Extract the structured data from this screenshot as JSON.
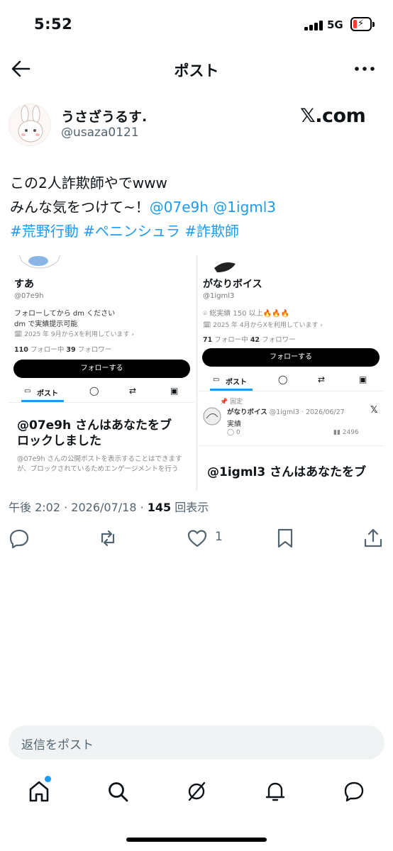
{
  "status": {
    "time": "5:52",
    "network": "5G"
  },
  "header": {
    "title": "ポスト"
  },
  "author": {
    "name": "うさざうるす.",
    "handle": "@usaza0121",
    "source": "𝕏.com"
  },
  "post": {
    "line1": "この2人詐欺師やでwww",
    "line2_prefix": "みんな気をつけて~！",
    "mention1": "@07e9h",
    "mention2": "@1igml3",
    "hashtag1": "#荒野行動",
    "hashtag2": "#ペニンシュラ",
    "hashtag3": "#詐欺師"
  },
  "embed": {
    "left": {
      "name": "すあ",
      "handle": "@07e9h",
      "bio1": "フォローしてから dm ください",
      "bio2": "dm で実績提示可能",
      "joined": "2025 年 9月からXを利用しています ›",
      "following_count": "110",
      "following_label": "フォロー中",
      "followers_count": "39",
      "followers_label": "フォロワー",
      "follow_button": "フォローする",
      "tab_post": "ポスト",
      "block_title1": "@07e9h さんはあなたをブ",
      "block_title2": "ロックしました",
      "block_desc1": "@07e9h さんの公開ポストを表示することはできます",
      "block_desc2": "が、ブロックされているためエンゲージメントを行う"
    },
    "right": {
      "name": "がなりボイス",
      "handle": "@1igml3",
      "bio1": "総実績 150 以上🔥🔥🔥",
      "joined": "2025 年 4月からXを利用しています ›",
      "following_count": "71",
      "following_label": "フォロー中",
      "followers_count": "42",
      "followers_label": "フォロワー",
      "follow_button": "フォローする",
      "tab_post": "ポスト",
      "pinned_label": "固定",
      "pinned_name": "がなりボイス",
      "pinned_meta": "@1igml3 · 2026/06/27",
      "pinned_text": "実績",
      "pinned_views": "2496",
      "block_title_partial": "@1igml3 さんはあなたをブ"
    }
  },
  "meta": {
    "time_date": "午後 2:02 · 2026/07/18 · ",
    "views_count": "145",
    "views_label": " 回表示"
  },
  "actions": {
    "like_count": "1"
  },
  "reply": {
    "placeholder": "返信をポスト"
  },
  "colors": {
    "accent": "#1d9bf0",
    "text": "#0f1419",
    "muted": "#536471"
  }
}
